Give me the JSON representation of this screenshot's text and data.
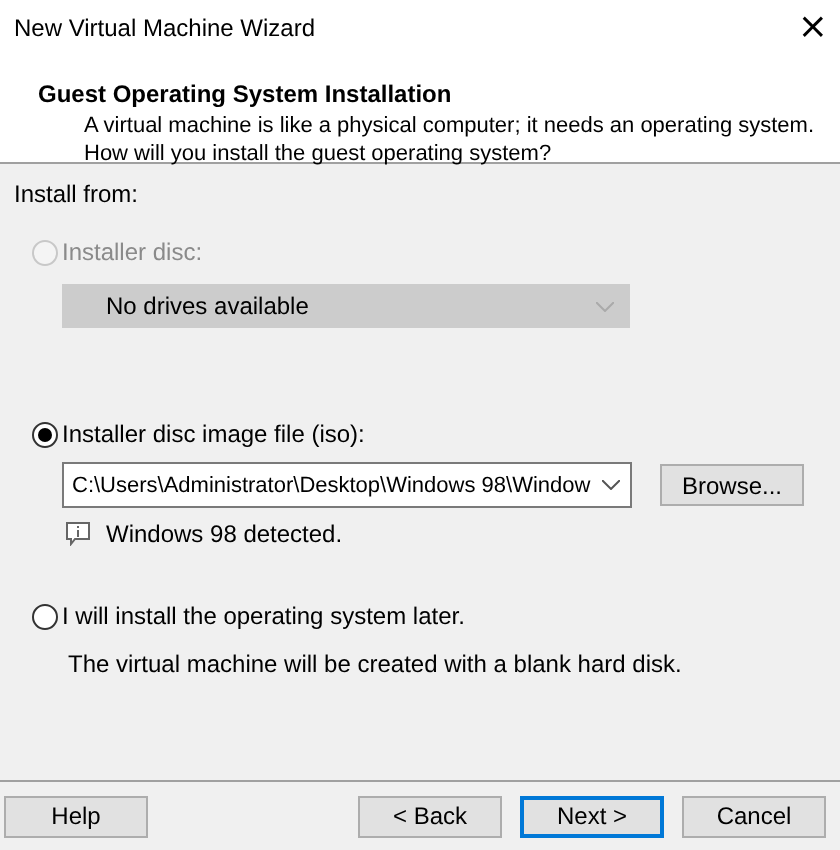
{
  "window": {
    "title": "New Virtual Machine Wizard",
    "close": "×"
  },
  "header": {
    "title": "Guest Operating System Installation",
    "description": "A virtual machine is like a physical computer; it needs an operating system. How will you install the guest operating system?"
  },
  "install_from": "Install from:",
  "options": [
    {
      "kind": "disc",
      "label": "Installer disc:",
      "selected": false,
      "disabled": true,
      "dropdown": "No drives available"
    },
    {
      "kind": "iso",
      "label": "Installer disc image file (iso):",
      "selected": true,
      "disabled": false,
      "path": "C:\\Users\\Administrator\\Desktop\\Windows 98\\Window",
      "browse": "Browse...",
      "note": "Windows 98 detected."
    },
    {
      "kind": "later",
      "label": "I will install the operating system later.",
      "selected": false,
      "disabled": false,
      "note": "The virtual machine will be created with a blank hard disk."
    }
  ],
  "buttons": [
    {
      "label": "Help",
      "default": false
    },
    {
      "label": "< Back",
      "default": false
    },
    {
      "label": "Next >",
      "default": true
    },
    {
      "label": "Cancel",
      "default": false
    }
  ]
}
